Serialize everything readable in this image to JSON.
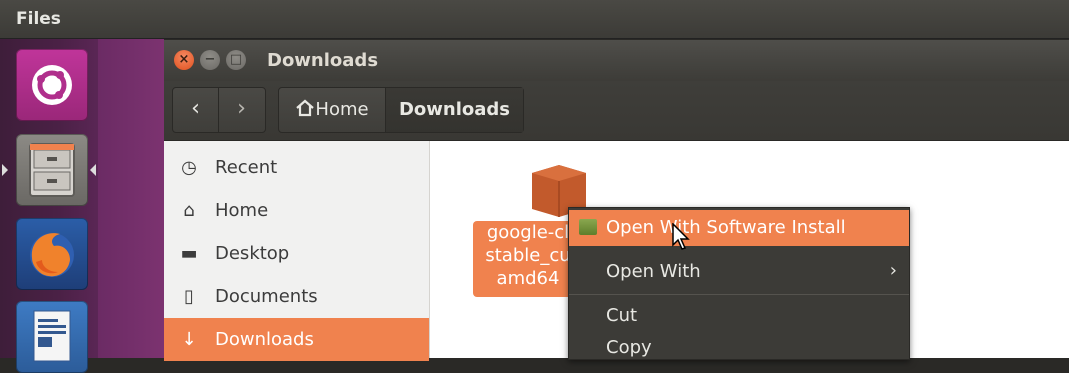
{
  "top_panel": {
    "title": "Files"
  },
  "launcher": {
    "items": [
      {
        "name": "ubuntu",
        "icon": "ubuntu-logo-icon"
      },
      {
        "name": "files",
        "icon": "file-cabinet-icon"
      },
      {
        "name": "firefox",
        "icon": "firefox-icon"
      },
      {
        "name": "writer",
        "icon": "libreoffice-writer-icon"
      }
    ]
  },
  "window": {
    "title": "Downloads",
    "controls": {
      "close": "×",
      "minimize": "−",
      "maximize": "□"
    }
  },
  "toolbar": {
    "back": "‹",
    "forward": "›",
    "path": {
      "home_label": "Home",
      "current_label": "Downloads"
    }
  },
  "sidebar": {
    "items": [
      {
        "label": "Recent",
        "icon": "clock-icon",
        "glyph": "◷"
      },
      {
        "label": "Home",
        "icon": "home-icon",
        "glyph": "⌂"
      },
      {
        "label": "Desktop",
        "icon": "folder-icon",
        "glyph": "▬"
      },
      {
        "label": "Documents",
        "icon": "document-icon",
        "glyph": "▯"
      },
      {
        "label": "Downloads",
        "icon": "download-icon",
        "glyph": "↓",
        "active": true
      }
    ]
  },
  "content": {
    "file": {
      "name_lines": [
        "google-cl",
        "stable_cu",
        "amd64"
      ],
      "icon": "package-icon"
    }
  },
  "context_menu": {
    "items": [
      {
        "label": "Open With Software Install",
        "hover": true,
        "icon": "software-install-icon"
      },
      {
        "label": "Open With",
        "submenu": "›"
      },
      {
        "label": "Cut"
      },
      {
        "label": "Copy"
      }
    ]
  },
  "colors": {
    "accent": "#f0824e",
    "launcher": "#4b2146",
    "dark": "#3c3b37"
  }
}
